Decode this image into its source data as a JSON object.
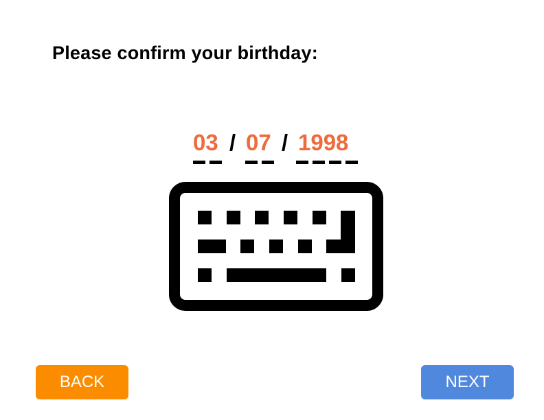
{
  "prompt": {
    "title": "Please confirm your birthday:"
  },
  "date": {
    "month": "03",
    "day": "07",
    "year": "1998",
    "separator": "/"
  },
  "keyboard": {
    "icon": "keyboard-icon"
  },
  "buttons": {
    "back_label": "BACK",
    "next_label": "NEXT"
  },
  "colors": {
    "date_value": "#ef6a3c",
    "back_button": "#fb8c00",
    "next_button": "#5088dd",
    "text": "#000000"
  }
}
